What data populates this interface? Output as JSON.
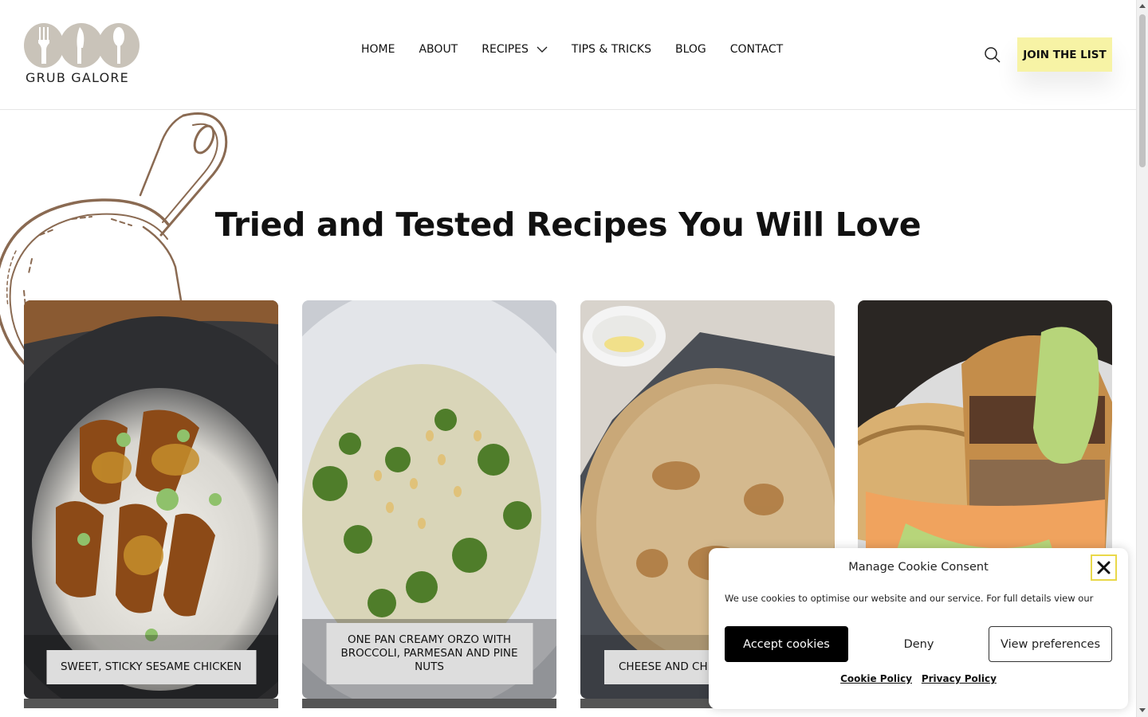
{
  "brand": {
    "name": "GRUB GALORE"
  },
  "nav": {
    "items": [
      "HOME",
      "ABOUT",
      "RECIPES",
      "TIPS & TRICKS",
      "BLOG",
      "CONTACT"
    ]
  },
  "header": {
    "join_label": "JOIN THE LIST",
    "search_icon": "search-icon"
  },
  "hero": {
    "title": "Tried and Tested Recipes You Will Love"
  },
  "cards": [
    {
      "label": "SWEET, STICKY SESAME CHICKEN"
    },
    {
      "label": "ONE PAN CREAMY ORZO WITH BROCCOLI, PARMESAN AND PINE NUTS"
    },
    {
      "label": "CHEESE AND CHI"
    },
    {
      "label": ""
    }
  ],
  "cookie": {
    "title": "Manage Cookie Consent",
    "text": "We use cookies to optimise our website and our service. For full details view our",
    "accept": "Accept cookies",
    "deny": "Deny",
    "preferences": "View preferences",
    "links": [
      "Cookie Policy",
      "Privacy Policy"
    ]
  },
  "colors": {
    "accent": "#f7f3a5",
    "logo": "#c9c3b9",
    "pan": "#8a6a52"
  }
}
